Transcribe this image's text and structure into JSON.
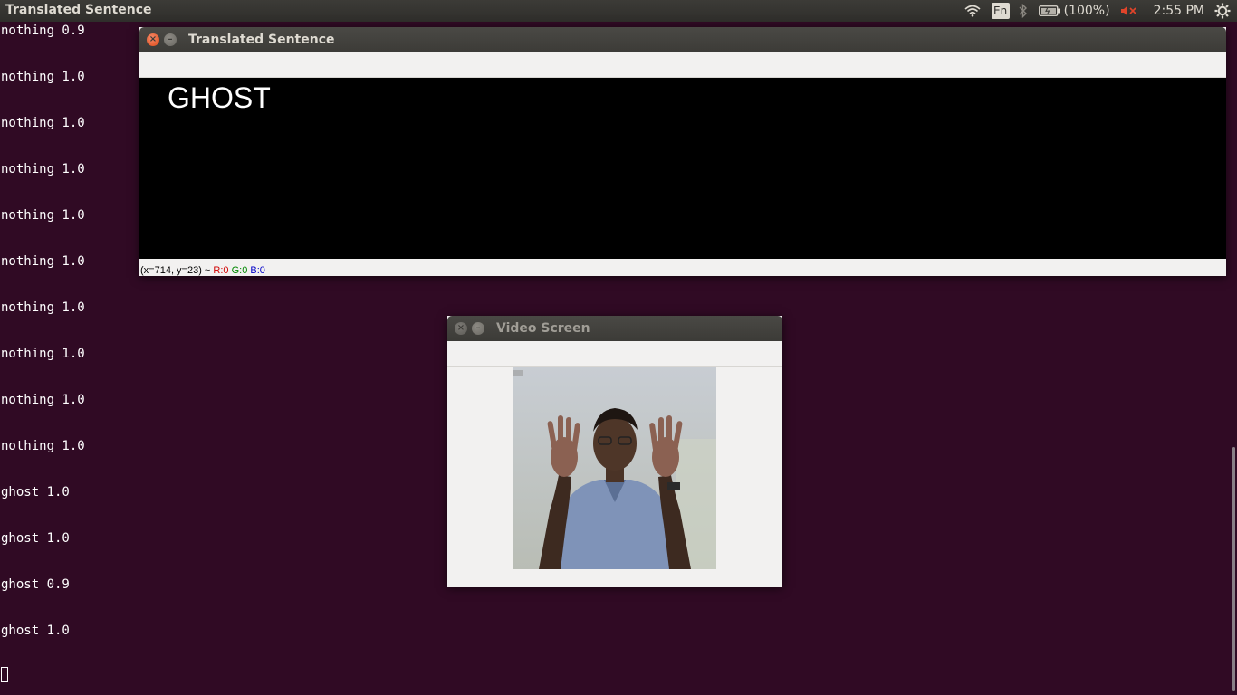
{
  "top_panel": {
    "app_title": "Translated Sentence",
    "keyboard_layout": "En",
    "battery_text": "(100%)",
    "clock": "2:55 PM"
  },
  "terminal": {
    "lines": [
      "nothing 0.9",
      "nothing 1.0",
      "nothing 1.0",
      "nothing 1.0",
      "nothing 1.0",
      "nothing 1.0",
      "nothing 1.0",
      "nothing 1.0",
      "nothing 1.0",
      "nothing 1.0",
      "ghost 1.0",
      "ghost 1.0",
      "ghost 0.9",
      "ghost 1.0"
    ]
  },
  "translated_window": {
    "title": "Translated Sentence",
    "sentence": "GHOST",
    "status": {
      "coords": "(x=714, y=23) ~",
      "r": "R:0",
      "g": "G:0",
      "b": "B:0"
    }
  },
  "video_window": {
    "title": "Video Screen"
  },
  "icons": {
    "wifi": "wifi-icon",
    "bluetooth": "bluetooth-icon",
    "battery": "battery-icon",
    "volume": "volume-muted-icon",
    "settings": "gear-icon"
  },
  "colors": {
    "terminal_bg": "#300a24",
    "panel_bg": "#3c3b37",
    "close_button": "#df4a16",
    "mute_red": "#e0442a"
  }
}
